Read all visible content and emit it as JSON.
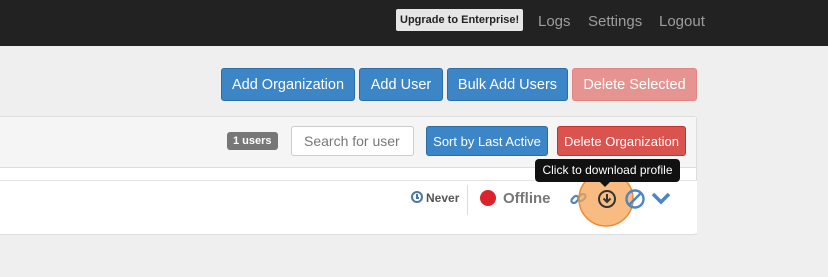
{
  "navbar": {
    "upgrade_label": "Upgrade to Enterprise!",
    "links": [
      "Logs",
      "Settings",
      "Logout"
    ]
  },
  "toolbar": {
    "add_org": "Add Organization",
    "add_user": "Add User",
    "bulk_add": "Bulk Add Users",
    "delete_selected": "Delete Selected"
  },
  "organization": {
    "user_count": "1 users",
    "search_placeholder": "Search for user",
    "sort_label": "Sort by Last Active",
    "delete_label": "Delete Organization"
  },
  "user": {
    "last_active": "Never",
    "status": "Offline",
    "status_color": "#d9242b",
    "actions": [
      "link-icon",
      "download-icon",
      "ban-icon",
      "chevron-down-icon"
    ]
  },
  "tooltip": {
    "text": "Click to download profile"
  },
  "colors": {
    "primary": "#3c85c6",
    "danger": "#d9534f",
    "navbar": "#222222",
    "highlight": "#f5a55a"
  }
}
